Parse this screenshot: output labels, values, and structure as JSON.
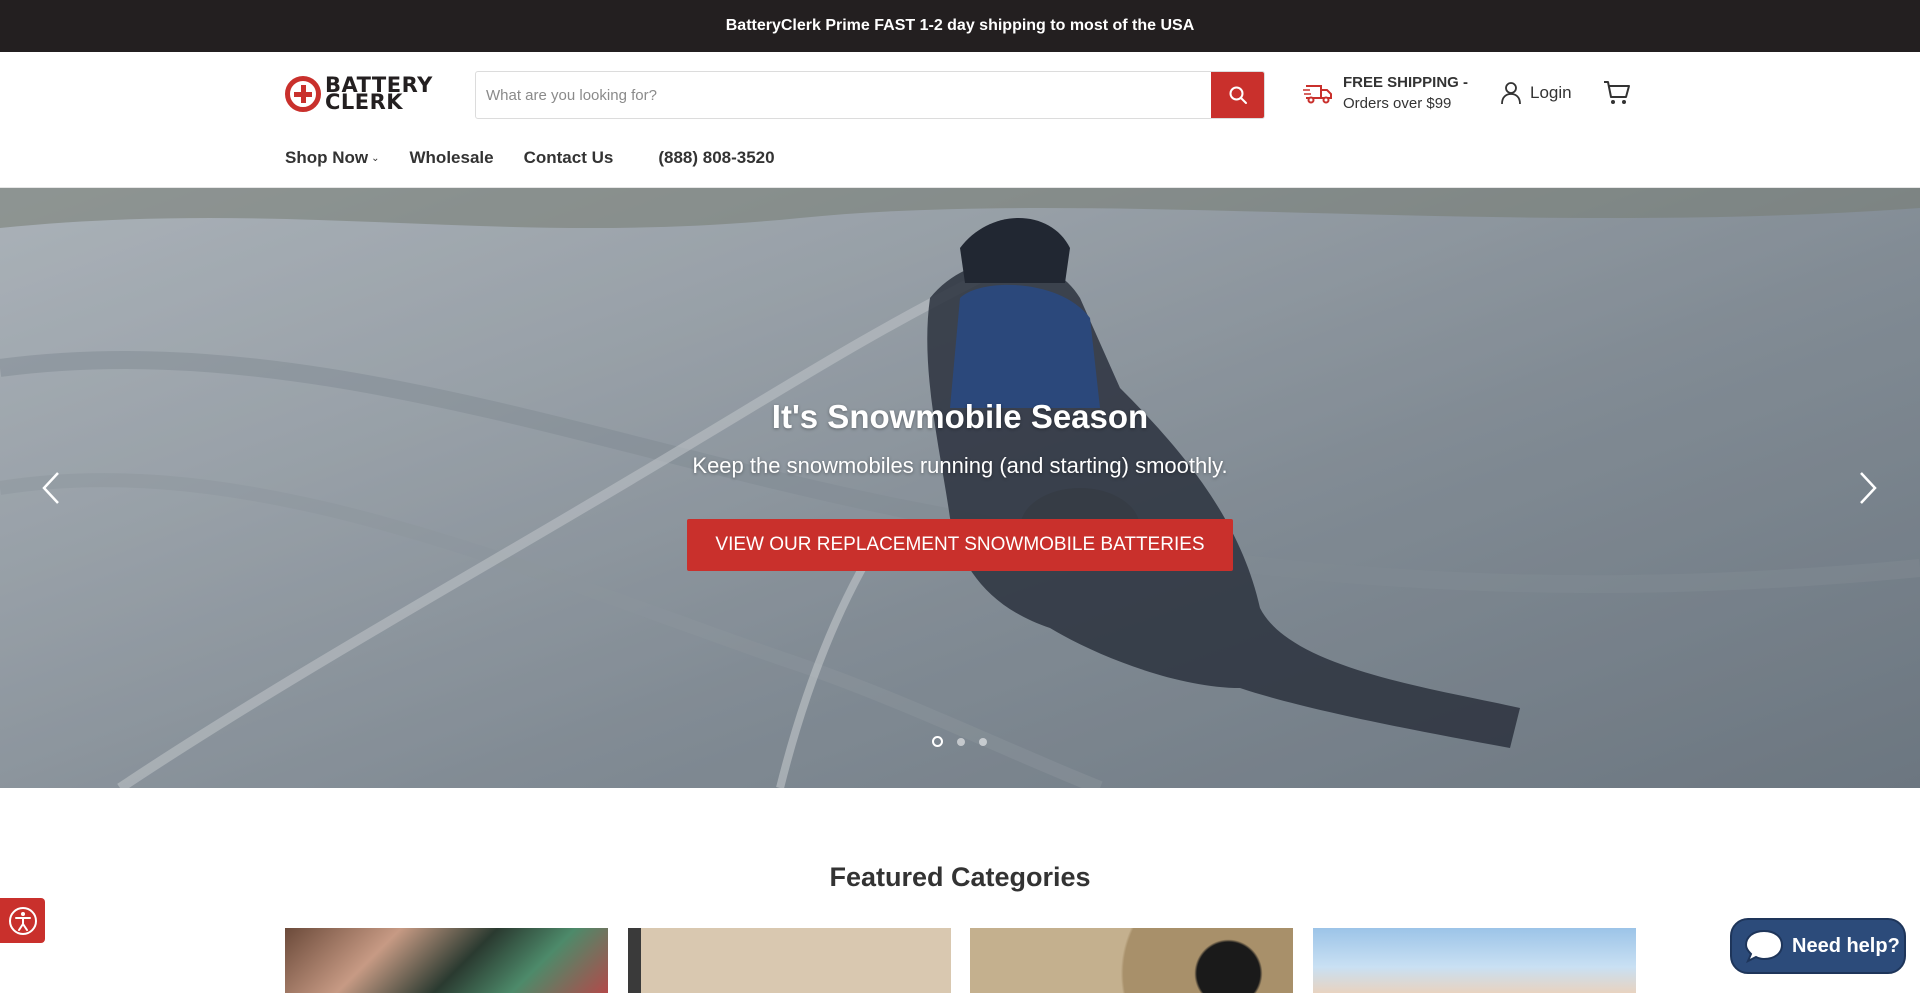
{
  "announcement": {
    "text": "BatteryClerk Prime FAST 1-2 day shipping to most of the USA"
  },
  "header": {
    "logo": {
      "line1": "BATTERY",
      "line2": "CLERK"
    },
    "search": {
      "placeholder": "What are you looking for?",
      "value": ""
    },
    "shipping": {
      "line1": "FREE SHIPPING -",
      "line2": "Orders over $99"
    },
    "login_label": "Login"
  },
  "nav": {
    "items": [
      {
        "label": "Shop Now",
        "has_dropdown": true
      },
      {
        "label": "Wholesale"
      },
      {
        "label": "Contact Us"
      }
    ],
    "phone": "(888) 808-3520"
  },
  "hero": {
    "title": "It's Snowmobile Season",
    "subtitle": "Keep the snowmobiles running (and starting) smoothly.",
    "button_label": "VIEW OUR REPLACEMENT SNOWMOBILE BATTERIES",
    "slides_count": 3,
    "active_slide": 1
  },
  "featured": {
    "title": "Featured Categories"
  },
  "help_widget": {
    "label": "Need help?"
  },
  "colors": {
    "brand_red": "#c9302c",
    "dark": "#231f20",
    "help_blue": "#2c4b7a"
  }
}
